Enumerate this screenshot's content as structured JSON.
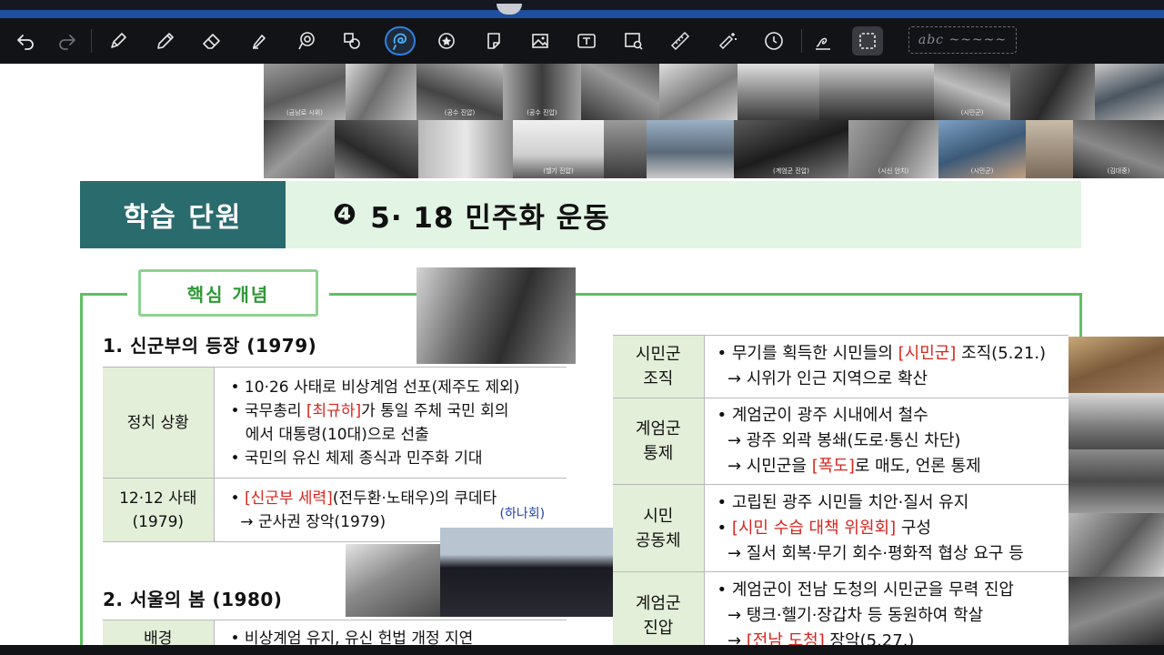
{
  "toolbar": {
    "tools": [
      {
        "name": "undo-icon"
      },
      {
        "name": "redo-icon"
      },
      {
        "name": "pen-icon"
      },
      {
        "name": "pencil-icon"
      },
      {
        "name": "eraser-icon"
      },
      {
        "name": "highlighter-icon"
      },
      {
        "name": "lasso-icon"
      },
      {
        "name": "shapes-icon"
      },
      {
        "name": "laser-pointer-icon"
      },
      {
        "name": "sticker-icon"
      },
      {
        "name": "sticky-note-icon"
      },
      {
        "name": "image-icon"
      },
      {
        "name": "text-box-icon"
      },
      {
        "name": "image-search-icon"
      },
      {
        "name": "ruler-icon"
      },
      {
        "name": "magic-wand-icon"
      },
      {
        "name": "timer-icon"
      },
      {
        "name": "handwriting-icon"
      },
      {
        "name": "selection-icon"
      }
    ],
    "text_preview": "abc ~~~~~"
  },
  "photos": {
    "captions": [
      "(금남로 시위)",
      "(공수 진압)",
      "(공수 진압)",
      "(시민군)",
      "(헬기 진압)",
      "(계엄군 진압)",
      "(시신 안치)",
      "(시민군)",
      "(김대중)"
    ]
  },
  "unit": {
    "label": "학습 단원",
    "number": "❹",
    "title": "5· 18 민주화 운동"
  },
  "concept_tab": "핵심  개념",
  "section1": {
    "heading": "1. 신군부의 등장 (1979)",
    "rows": [
      {
        "label": "정치 상황",
        "lines": [
          {
            "pre": "• 10·26 사태로 비상계엄 선포(제주도 제외)"
          },
          {
            "pre": "• 국무총리 ",
            "red": "[최규하]",
            "post": "가 통일 주체 국민 회의"
          },
          {
            "pre": "   에서 대통령(10대)으로 선출"
          },
          {
            "pre": "• 국민의 유신 체제 종식과 민주화 기대"
          }
        ]
      },
      {
        "label_l1": "12·12 사태",
        "label_l2": "(1979)",
        "lines": [
          {
            "pre": "• ",
            "red": "[신군부 세력]",
            "post": "(전두환·노태우)의 쿠데타"
          },
          {
            "note": "(하나회)"
          },
          {
            "pre": "  → 군사권 장악(1979)"
          }
        ]
      }
    ]
  },
  "section2": {
    "heading": "2. 서울의 봄 (1980)",
    "rows": [
      {
        "label": "배경",
        "lines": [
          {
            "pre": "• 비상계엄 유지, 유신 헌법 개정 지연"
          }
        ]
      }
    ]
  },
  "right_table": {
    "rows": [
      {
        "label_l1": "시민군",
        "label_l2": "조직",
        "lines": [
          {
            "pre": "• 무기를 획득한 시민들의 ",
            "red": "[시민군]",
            "post": " 조직(5.21.)"
          },
          {
            "pre": "  → 시위가 인근 지역으로 확산"
          }
        ]
      },
      {
        "label_l1": "계엄군",
        "label_l2": "통제",
        "lines": [
          {
            "pre": "• 계엄군이 광주 시내에서 철수"
          },
          {
            "pre": "  → 광주 외곽 봉쇄(도로·통신 차단)"
          },
          {
            "pre": "  → 시민군을 ",
            "red": "[폭도]",
            "post": "로 매도, 언론 통제"
          }
        ]
      },
      {
        "label_l1": "시민",
        "label_l2": "공동체",
        "lines": [
          {
            "pre": "• 고립된 광주 시민들 치안·질서 유지"
          },
          {
            "pre": "• ",
            "red": "[시민 수습 대책 위원회]",
            "post": " 구성"
          },
          {
            "pre": "  → 질서 회복·무기 회수·평화적 협상 요구 등"
          }
        ]
      },
      {
        "label_l1": "계엄군",
        "label_l2": "진압",
        "lines": [
          {
            "pre": "• 계엄군이 전남 도청의 시민군을 무력 진압"
          },
          {
            "pre": "  → 탱크·헬기·장갑차 등 동원하여 학살"
          },
          {
            "pre": "  → ",
            "red": "[전남 도청]",
            "post": " 장악(5.27.)"
          }
        ]
      }
    ]
  }
}
